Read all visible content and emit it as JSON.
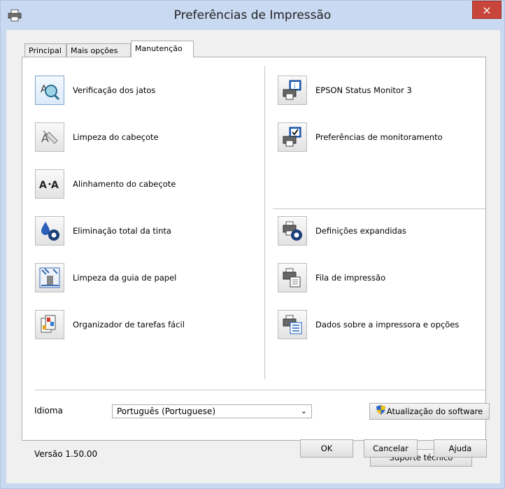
{
  "window": {
    "title": "Preferências de Impressão",
    "close_label": "×"
  },
  "tabs": [
    {
      "label": "Principal",
      "active": false
    },
    {
      "label": "Mais opções",
      "active": false
    },
    {
      "label": "Manutenção",
      "active": true
    }
  ],
  "left_items": [
    {
      "label": "Verificação dos jatos",
      "icon": "nozzle-check-icon"
    },
    {
      "label": "Limpeza do cabeçote",
      "icon": "head-cleaning-icon"
    },
    {
      "label": "Alinhamento do cabeçote",
      "icon": "head-alignment-icon"
    },
    {
      "label": "Eliminação total da tinta",
      "icon": "power-ink-flushing-icon"
    },
    {
      "label": "Limpeza da guia de papel",
      "icon": "paper-guide-cleaning-icon"
    },
    {
      "label": "Organizador de tarefas fácil",
      "icon": "job-arranger-icon"
    }
  ],
  "right_items": [
    {
      "label": "EPSON Status Monitor 3",
      "icon": "status-monitor-icon"
    },
    {
      "label": "Preferências de monitoramento",
      "icon": "monitoring-preferences-icon"
    },
    {
      "label": "Definições expandidas",
      "icon": "extended-settings-icon"
    },
    {
      "label": "Fila de impressão",
      "icon": "print-queue-icon"
    },
    {
      "label": "Dados sobre a impressora e opções",
      "icon": "printer-info-icon"
    }
  ],
  "language": {
    "label": "Idioma",
    "selected": "Português (Portuguese)"
  },
  "buttons": {
    "software_update": "Atualização do software",
    "tech_support": "Suporte técnico",
    "ok": "OK",
    "cancel": "Cancelar",
    "help": "Ajuda"
  },
  "version": "Versão 1.50.00",
  "colors": {
    "titlebar": "#c9d9f2",
    "close": "#c7453b",
    "selected_icon_border": "#7da2ce"
  }
}
